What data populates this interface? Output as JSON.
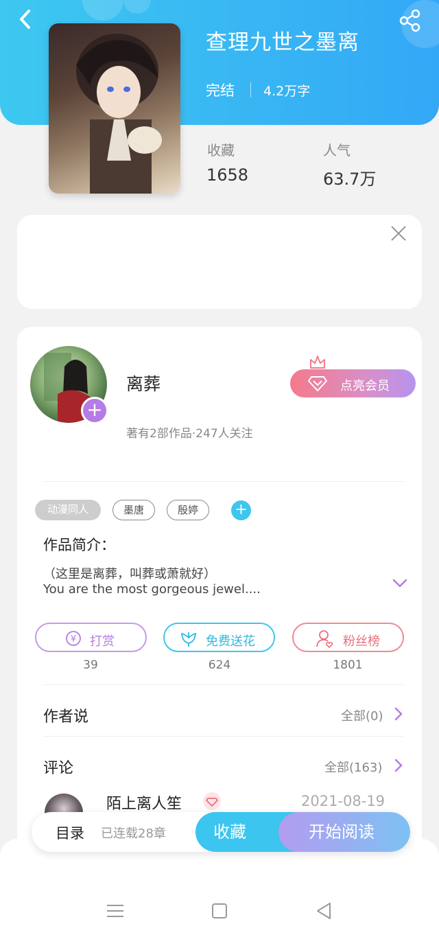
{
  "colors": {
    "header_gradient": [
      "#3cc8f0",
      "#33a8f6"
    ],
    "accent_blue": "#3cc5ee",
    "accent_purple": "#b57be6",
    "vip_gradient": [
      "#f47a8b",
      "#b594ee"
    ]
  },
  "header": {
    "back_icon": "back-arrow-icon",
    "share_icon": "share-icon"
  },
  "book": {
    "title": "查理九世之墨离",
    "status": "完结",
    "word_count": "4.2万字",
    "stats": {
      "favorites_label": "收藏",
      "favorites_value": "1658",
      "popularity_label": "人气",
      "popularity_value": "63.7万"
    }
  },
  "ad": {
    "close_icon": "close-icon"
  },
  "author": {
    "name": "离葬",
    "meta": "著有2部作品·247人关注",
    "vip_button": "点亮会员"
  },
  "tags": [
    "动漫同人",
    "墨唐",
    "殷婷"
  ],
  "intro": {
    "title": "作品简介：",
    "line1": "（这里是离葬，叫葬或萧就好）",
    "line2": "You are the most gorgeous jewel...."
  },
  "actions": [
    {
      "label": "打赏",
      "count": "39",
      "icon": "yen-coin-icon"
    },
    {
      "label": "免费送花",
      "count": "624",
      "icon": "flower-icon"
    },
    {
      "label": "粉丝榜",
      "count": "1801",
      "icon": "fan-user-icon"
    }
  ],
  "author_says": {
    "title": "作者说",
    "link": "全部(0)"
  },
  "comments": {
    "title": "评论",
    "link": "全部(163)",
    "first": {
      "user": "陌上离人笙",
      "date": "2021-08-19"
    }
  },
  "bottom_bar": {
    "toc": "目录",
    "chapters": "已连载28章",
    "collect": "收藏",
    "read": "开始阅读"
  },
  "system_nav": [
    "menu-icon",
    "home-square-icon",
    "back-triangle-icon"
  ]
}
